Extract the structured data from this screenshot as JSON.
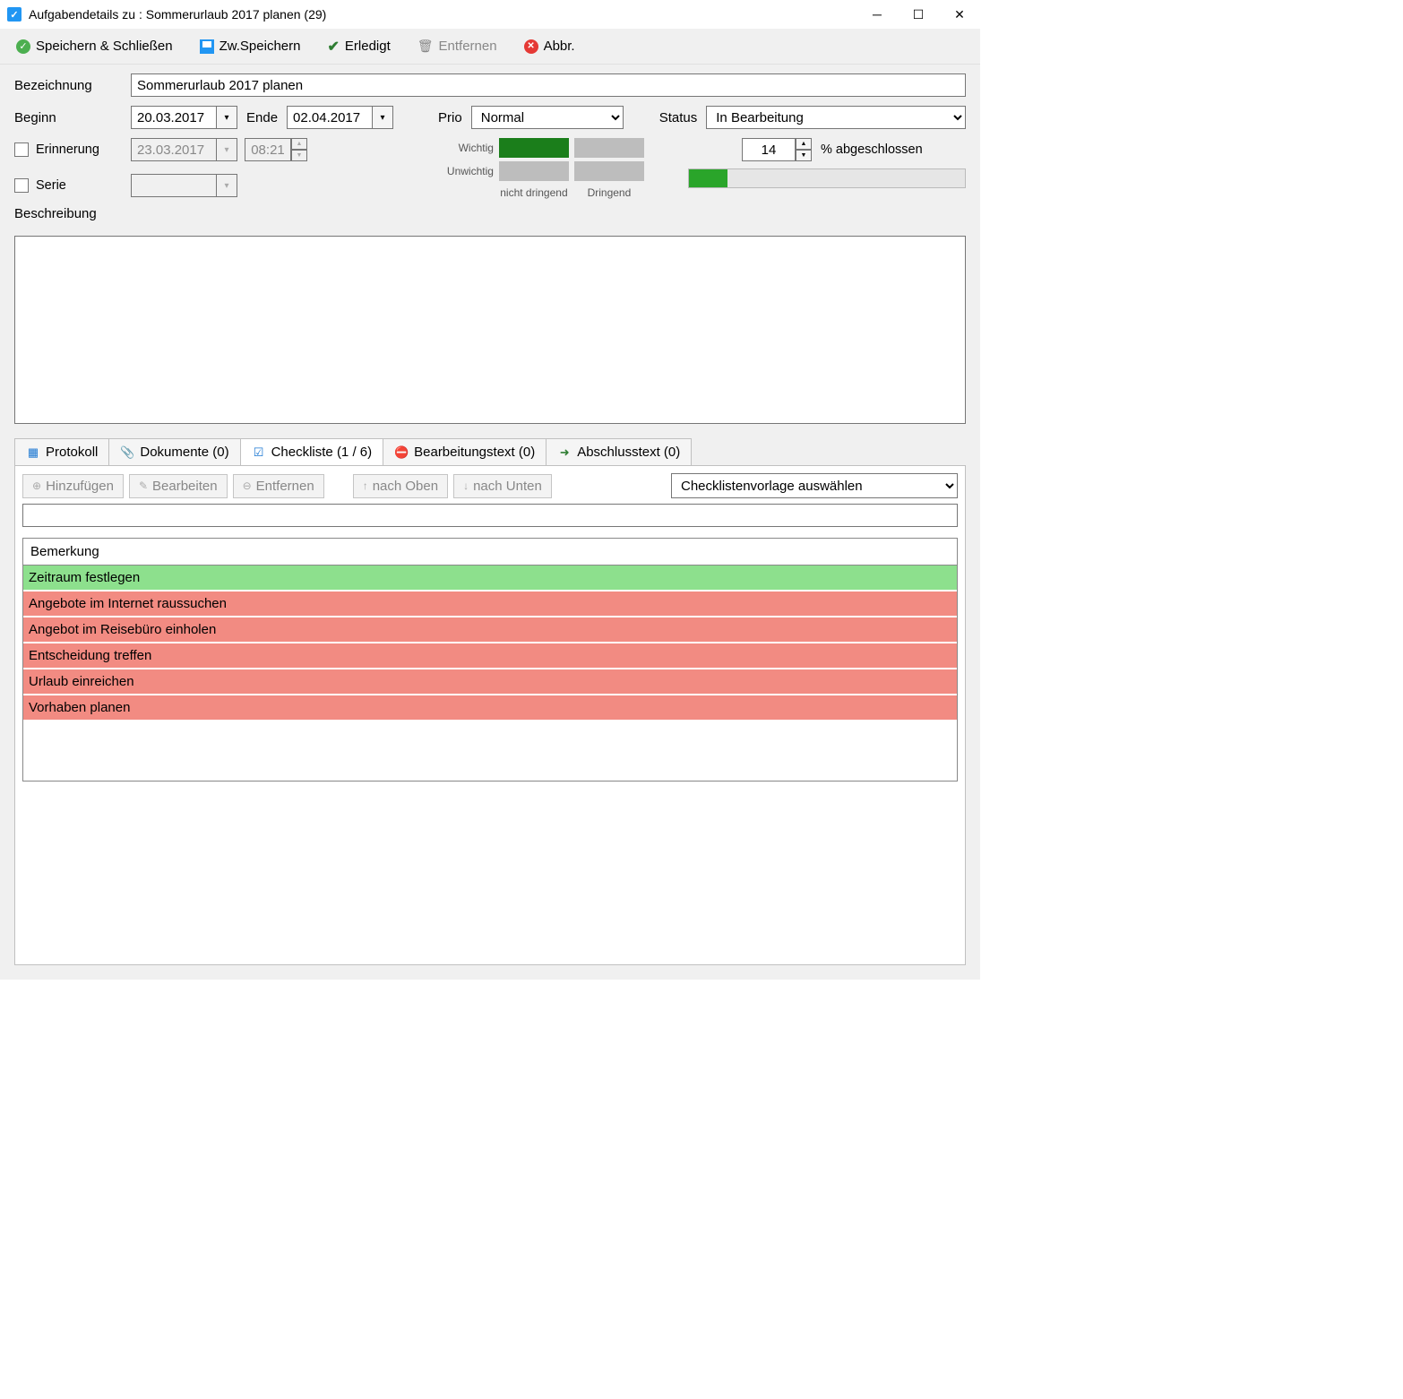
{
  "window": {
    "title": "Aufgabendetails zu : Sommerurlaub 2017 planen (29)"
  },
  "toolbar": {
    "save_close": "Speichern & Schließen",
    "save": "Zw.Speichern",
    "done": "Erledigt",
    "remove": "Entfernen",
    "cancel": "Abbr."
  },
  "form": {
    "label_name": "Bezeichnung",
    "name": "Sommerurlaub 2017 planen",
    "label_begin": "Beginn",
    "begin": "20.03.2017",
    "label_end": "Ende",
    "end": "02.04.2017",
    "label_prio": "Prio",
    "prio": "Normal",
    "label_status": "Status",
    "status": "In Bearbeitung",
    "label_reminder": "Erinnerung",
    "reminder_date": "23.03.2017",
    "reminder_time": "08:21",
    "label_series": "Serie",
    "label_desc": "Beschreibung",
    "matrix": {
      "row1": "Wichtig",
      "row2": "Unwichtig",
      "col1": "nicht dringend",
      "col2": "Dringend"
    },
    "progress_value": "14",
    "progress_label": "% abgeschlossen",
    "progress_percent": 14
  },
  "tabs": {
    "protokoll": "Protokoll",
    "dokumente": "Dokumente (0)",
    "checkliste": "Checkliste (1 / 6)",
    "bearbeitung": "Bearbeitungstext (0)",
    "abschluss": "Abschlusstext (0)"
  },
  "checklist": {
    "btn_add": "Hinzufügen",
    "btn_edit": "Bearbeiten",
    "btn_remove": "Entfernen",
    "btn_up": "nach Oben",
    "btn_down": "nach Unten",
    "template_placeholder": "Checklistenvorlage auswählen",
    "header": "Bemerkung",
    "items": [
      {
        "text": "Zeitraum festlegen",
        "done": true
      },
      {
        "text": "Angebote im Internet raussuchen",
        "done": false
      },
      {
        "text": "Angebot im Reisebüro einholen",
        "done": false
      },
      {
        "text": "Entscheidung treffen",
        "done": false
      },
      {
        "text": "Urlaub einreichen",
        "done": false
      },
      {
        "text": "Vorhaben planen",
        "done": false
      }
    ]
  }
}
